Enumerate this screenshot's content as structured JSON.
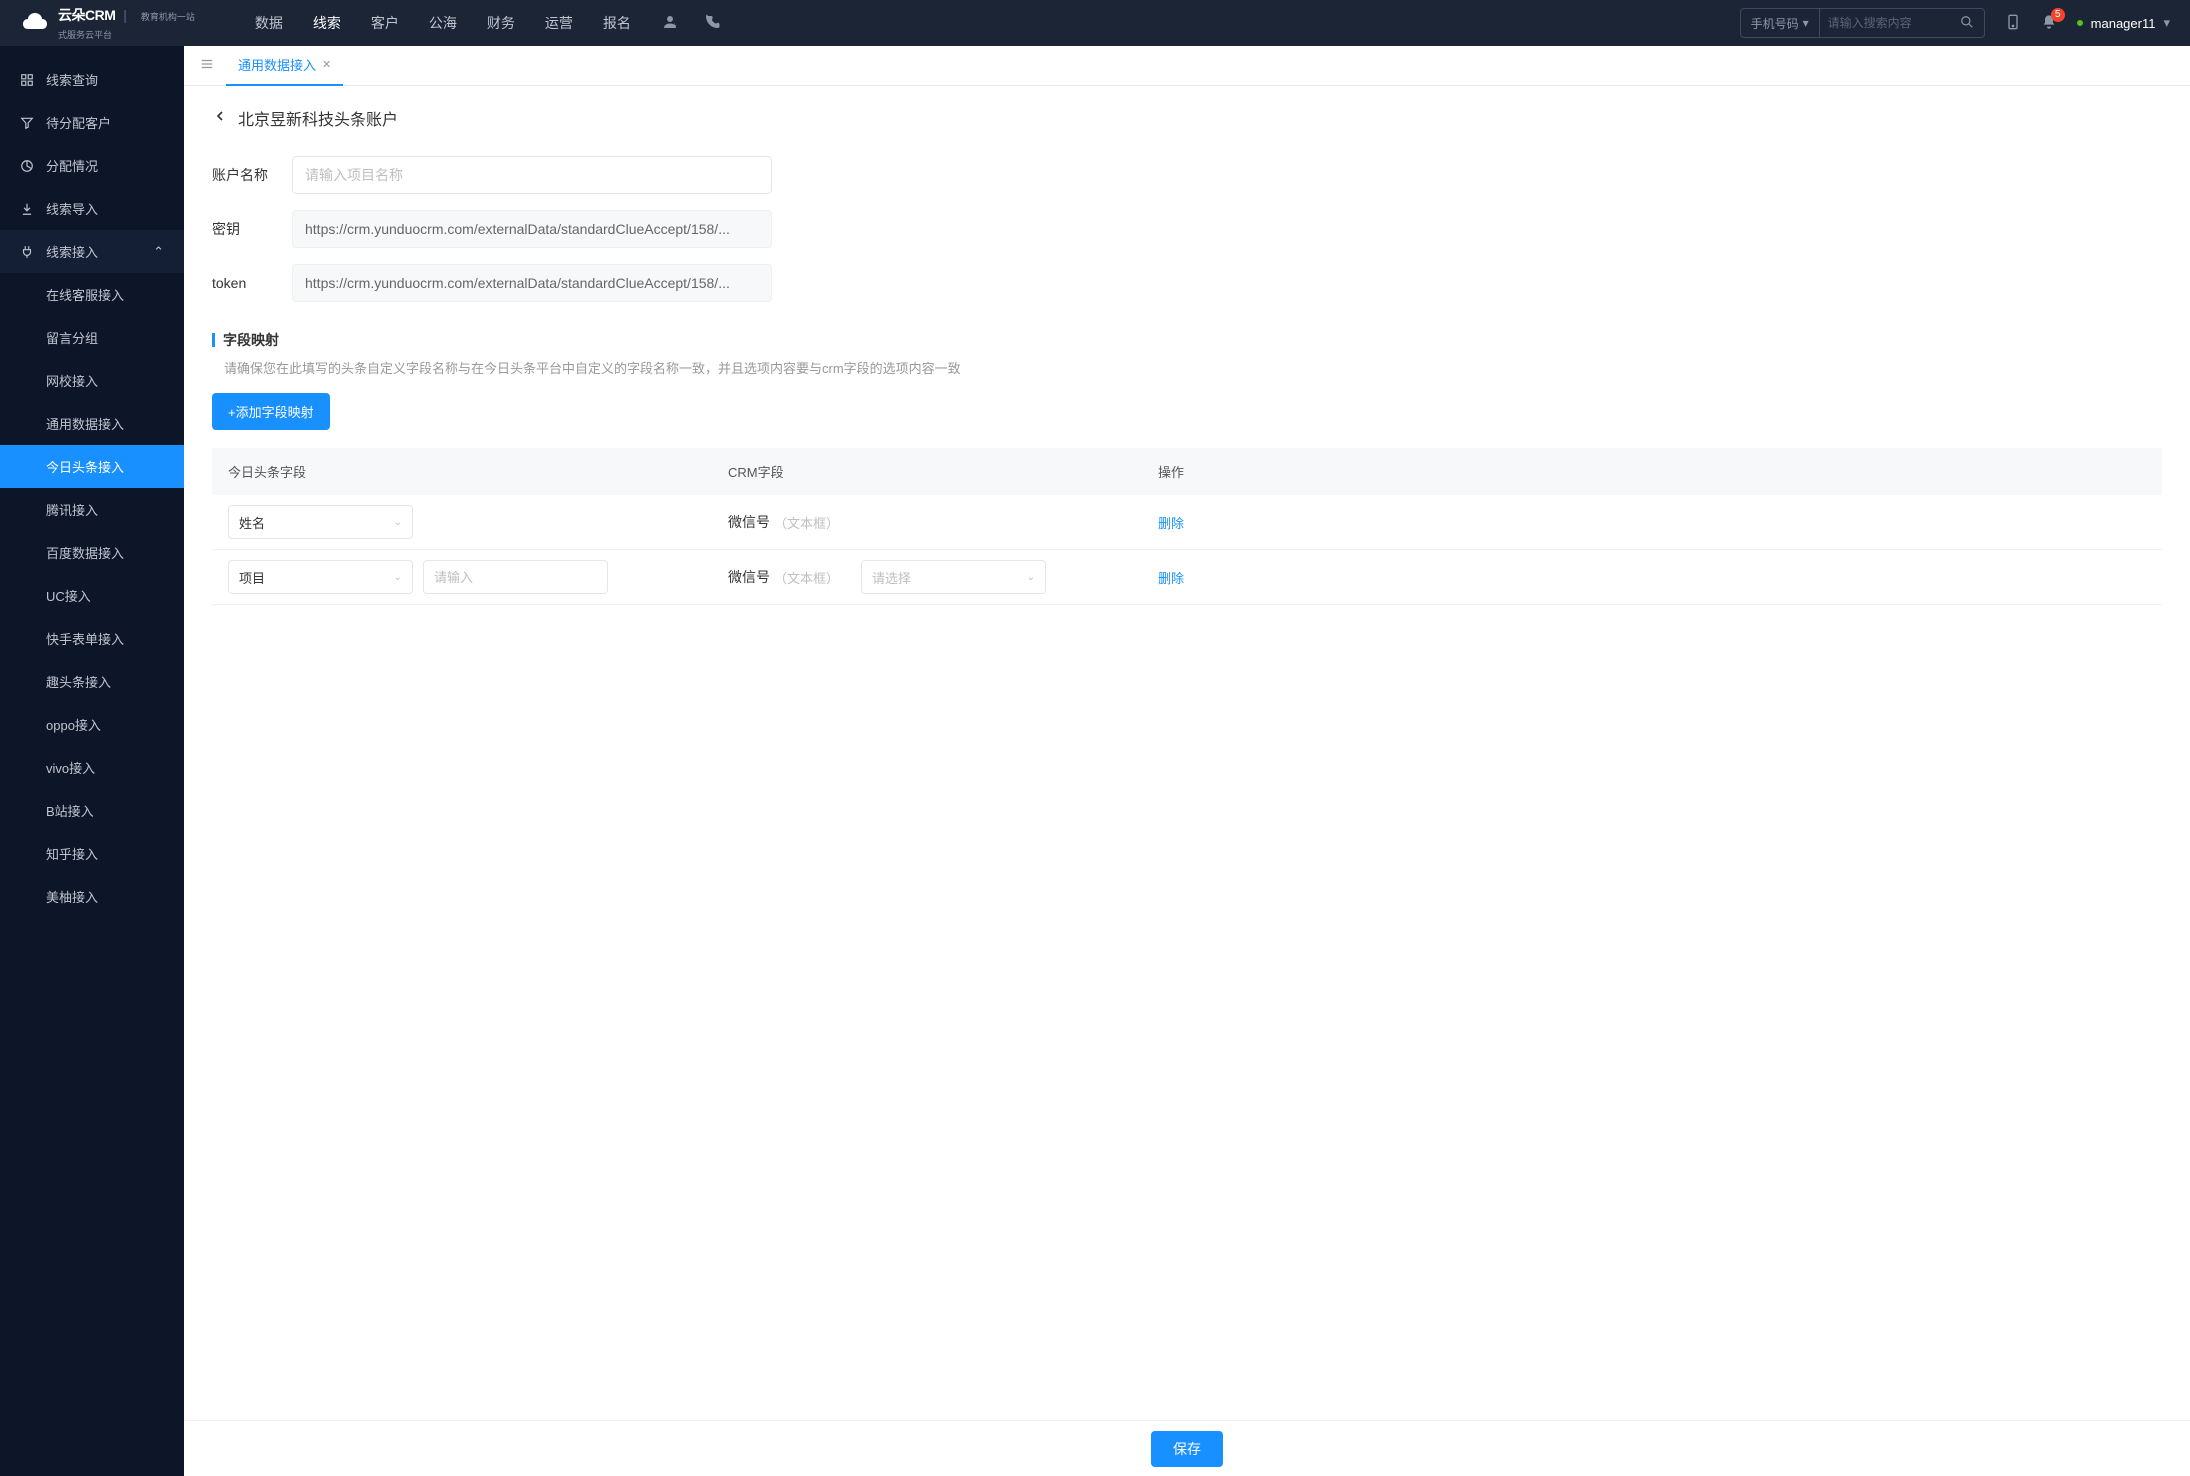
{
  "header": {
    "logo_text": "云朵CRM",
    "logo_sub1": "教育机构一站",
    "logo_sub2": "式服务云平台",
    "nav": [
      "数据",
      "线索",
      "客户",
      "公海",
      "财务",
      "运营",
      "报名"
    ],
    "nav_active": 1,
    "search_select": "手机号码",
    "search_placeholder": "请输入搜索内容",
    "notif_count": "5",
    "username": "manager11"
  },
  "sidebar": {
    "items": [
      {
        "label": "线索查询",
        "icon": "grid"
      },
      {
        "label": "待分配客户",
        "icon": "filter"
      },
      {
        "label": "分配情况",
        "icon": "pie"
      },
      {
        "label": "线索导入",
        "icon": "export"
      },
      {
        "label": "线索接入",
        "icon": "plug",
        "expanded": true,
        "children": [
          "在线客服接入",
          "留言分组",
          "网校接入",
          "通用数据接入",
          "今日头条接入",
          "腾讯接入",
          "百度数据接入",
          "UC接入",
          "快手表单接入",
          "趣头条接入",
          "oppo接入",
          "vivo接入",
          "B站接入",
          "知乎接入",
          "美柚接入"
        ],
        "active_child": 4
      }
    ]
  },
  "tabs": {
    "current": "通用数据接入"
  },
  "page": {
    "title": "北京昱新科技头条账户",
    "form": {
      "account_label": "账户名称",
      "account_placeholder": "请输入项目名称",
      "secret_label": "密钥",
      "secret_value": "https://crm.yunduocrm.com/externalData/standardClueAccept/158/...",
      "token_label": "token",
      "token_value": "https://crm.yunduocrm.com/externalData/standardClueAccept/158/..."
    },
    "mapping": {
      "title": "字段映射",
      "desc": "请确保您在此填写的头条自定义字段名称与在今日头条平台中自定义的字段名称一致，并且选项内容要与crm字段的选项内容一致",
      "add_btn": "+添加字段映射",
      "columns": {
        "c1": "今日头条字段",
        "c2": "CRM字段",
        "c3": "操作"
      },
      "rows": [
        {
          "sel1": "姓名",
          "sel1_ph": false,
          "input": null,
          "crm": "微信号",
          "crm_sub": "（文本框）",
          "sel2": null,
          "del": "删除"
        },
        {
          "sel1": "项目",
          "sel1_ph": false,
          "input_ph": "请输入",
          "crm": "微信号",
          "crm_sub": "（文本框）",
          "sel2_ph": "请选择",
          "del": "删除"
        }
      ]
    },
    "save_btn": "保存"
  }
}
